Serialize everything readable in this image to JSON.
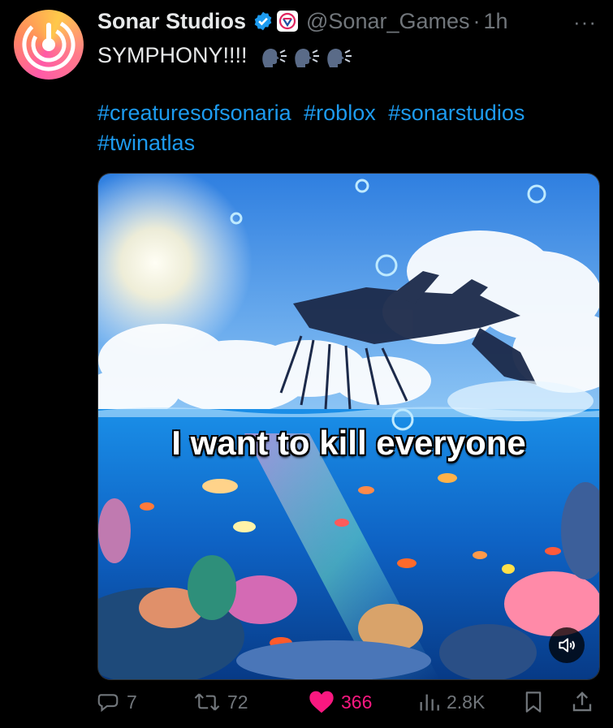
{
  "tweet": {
    "author_name": "Sonar Studios",
    "handle": "@Sonar_Games",
    "separator": "·",
    "time": "1h",
    "text": "SYMPHONY!!!!",
    "emoji_icons": [
      "speaking-head-icon",
      "speaking-head-icon",
      "speaking-head-icon"
    ],
    "hashtags": [
      "#creaturesofsonaria",
      "#roblox",
      "#sonarstudios",
      "#twinatlas"
    ],
    "more_label": "···"
  },
  "media": {
    "caption": "I want to kill everyone",
    "volume_icon": "speaker-muted-icon"
  },
  "actions": {
    "replies": "7",
    "reposts": "72",
    "likes": "366",
    "views": "2.8K"
  },
  "colors": {
    "background": "#000000",
    "text": "#e7e9ea",
    "muted": "#71767b",
    "link": "#1d9bf0",
    "like": "#f91880",
    "verified": "#1d9bf0"
  }
}
